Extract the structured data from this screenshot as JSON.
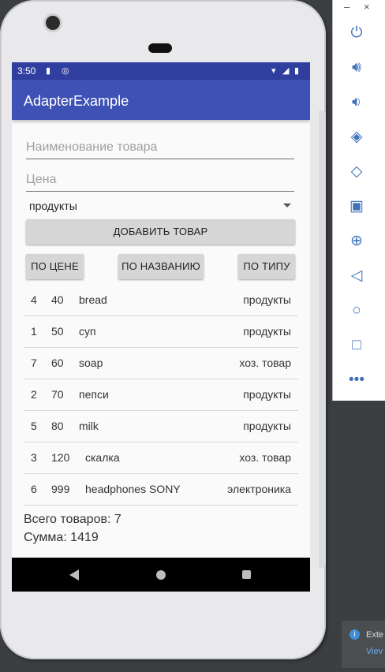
{
  "status_bar": {
    "time": "3:50"
  },
  "app_bar": {
    "title": "AdapterExample"
  },
  "form": {
    "name_placeholder": "Наименование товара",
    "price_placeholder": "Цена",
    "category_selected": "продукты",
    "add_button": "ДОБАВИТЬ ТОВАР"
  },
  "sort_buttons": {
    "by_price": "ПО ЦЕНЕ",
    "by_name": "ПО НАЗВАНИЮ",
    "by_type": "ПО ТИПУ"
  },
  "items": [
    {
      "id": "4",
      "price": "40",
      "name": "bread",
      "type": "продукты"
    },
    {
      "id": "1",
      "price": "50",
      "name": "суп",
      "type": "продукты"
    },
    {
      "id": "7",
      "price": "60",
      "name": "soap",
      "type": "хоз. товар"
    },
    {
      "id": "2",
      "price": "70",
      "name": "пепси",
      "type": "продукты"
    },
    {
      "id": "5",
      "price": "80",
      "name": "milk",
      "type": "продукты"
    },
    {
      "id": "3",
      "price": "120",
      "name": "скалка",
      "type": "хоз. товар"
    },
    {
      "id": "6",
      "price": "999",
      "name": "headphones SONY",
      "type": "электроника"
    }
  ],
  "summary": {
    "total_items": "Всего товаров: 7",
    "total_sum": "Сумма: 1419"
  },
  "emulator_toolbar": {
    "minimize": "–",
    "close": "×",
    "icons": [
      "power-icon",
      "volume-up-icon",
      "volume-down-icon",
      "rotate-left-icon",
      "rotate-right-icon",
      "camera-icon",
      "zoom-icon",
      "back-icon",
      "home-icon",
      "overview-icon",
      "more-icon"
    ]
  },
  "notification": {
    "line1": "Exte",
    "line2": "Viev"
  }
}
